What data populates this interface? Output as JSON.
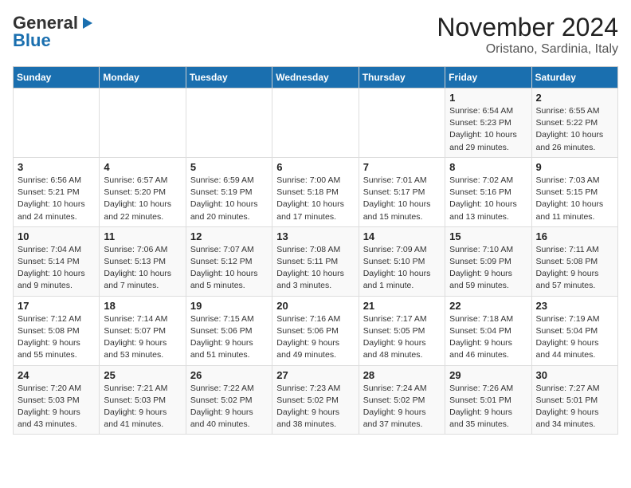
{
  "header": {
    "logo_line1": "General",
    "logo_line2": "Blue",
    "month": "November 2024",
    "location": "Oristano, Sardinia, Italy"
  },
  "weekdays": [
    "Sunday",
    "Monday",
    "Tuesday",
    "Wednesday",
    "Thursday",
    "Friday",
    "Saturday"
  ],
  "weeks": [
    [
      {
        "day": "",
        "info": ""
      },
      {
        "day": "",
        "info": ""
      },
      {
        "day": "",
        "info": ""
      },
      {
        "day": "",
        "info": ""
      },
      {
        "day": "",
        "info": ""
      },
      {
        "day": "1",
        "info": "Sunrise: 6:54 AM\nSunset: 5:23 PM\nDaylight: 10 hours and 29 minutes."
      },
      {
        "day": "2",
        "info": "Sunrise: 6:55 AM\nSunset: 5:22 PM\nDaylight: 10 hours and 26 minutes."
      }
    ],
    [
      {
        "day": "3",
        "info": "Sunrise: 6:56 AM\nSunset: 5:21 PM\nDaylight: 10 hours and 24 minutes."
      },
      {
        "day": "4",
        "info": "Sunrise: 6:57 AM\nSunset: 5:20 PM\nDaylight: 10 hours and 22 minutes."
      },
      {
        "day": "5",
        "info": "Sunrise: 6:59 AM\nSunset: 5:19 PM\nDaylight: 10 hours and 20 minutes."
      },
      {
        "day": "6",
        "info": "Sunrise: 7:00 AM\nSunset: 5:18 PM\nDaylight: 10 hours and 17 minutes."
      },
      {
        "day": "7",
        "info": "Sunrise: 7:01 AM\nSunset: 5:17 PM\nDaylight: 10 hours and 15 minutes."
      },
      {
        "day": "8",
        "info": "Sunrise: 7:02 AM\nSunset: 5:16 PM\nDaylight: 10 hours and 13 minutes."
      },
      {
        "day": "9",
        "info": "Sunrise: 7:03 AM\nSunset: 5:15 PM\nDaylight: 10 hours and 11 minutes."
      }
    ],
    [
      {
        "day": "10",
        "info": "Sunrise: 7:04 AM\nSunset: 5:14 PM\nDaylight: 10 hours and 9 minutes."
      },
      {
        "day": "11",
        "info": "Sunrise: 7:06 AM\nSunset: 5:13 PM\nDaylight: 10 hours and 7 minutes."
      },
      {
        "day": "12",
        "info": "Sunrise: 7:07 AM\nSunset: 5:12 PM\nDaylight: 10 hours and 5 minutes."
      },
      {
        "day": "13",
        "info": "Sunrise: 7:08 AM\nSunset: 5:11 PM\nDaylight: 10 hours and 3 minutes."
      },
      {
        "day": "14",
        "info": "Sunrise: 7:09 AM\nSunset: 5:10 PM\nDaylight: 10 hours and 1 minute."
      },
      {
        "day": "15",
        "info": "Sunrise: 7:10 AM\nSunset: 5:09 PM\nDaylight: 9 hours and 59 minutes."
      },
      {
        "day": "16",
        "info": "Sunrise: 7:11 AM\nSunset: 5:08 PM\nDaylight: 9 hours and 57 minutes."
      }
    ],
    [
      {
        "day": "17",
        "info": "Sunrise: 7:12 AM\nSunset: 5:08 PM\nDaylight: 9 hours and 55 minutes."
      },
      {
        "day": "18",
        "info": "Sunrise: 7:14 AM\nSunset: 5:07 PM\nDaylight: 9 hours and 53 minutes."
      },
      {
        "day": "19",
        "info": "Sunrise: 7:15 AM\nSunset: 5:06 PM\nDaylight: 9 hours and 51 minutes."
      },
      {
        "day": "20",
        "info": "Sunrise: 7:16 AM\nSunset: 5:06 PM\nDaylight: 9 hours and 49 minutes."
      },
      {
        "day": "21",
        "info": "Sunrise: 7:17 AM\nSunset: 5:05 PM\nDaylight: 9 hours and 48 minutes."
      },
      {
        "day": "22",
        "info": "Sunrise: 7:18 AM\nSunset: 5:04 PM\nDaylight: 9 hours and 46 minutes."
      },
      {
        "day": "23",
        "info": "Sunrise: 7:19 AM\nSunset: 5:04 PM\nDaylight: 9 hours and 44 minutes."
      }
    ],
    [
      {
        "day": "24",
        "info": "Sunrise: 7:20 AM\nSunset: 5:03 PM\nDaylight: 9 hours and 43 minutes."
      },
      {
        "day": "25",
        "info": "Sunrise: 7:21 AM\nSunset: 5:03 PM\nDaylight: 9 hours and 41 minutes."
      },
      {
        "day": "26",
        "info": "Sunrise: 7:22 AM\nSunset: 5:02 PM\nDaylight: 9 hours and 40 minutes."
      },
      {
        "day": "27",
        "info": "Sunrise: 7:23 AM\nSunset: 5:02 PM\nDaylight: 9 hours and 38 minutes."
      },
      {
        "day": "28",
        "info": "Sunrise: 7:24 AM\nSunset: 5:02 PM\nDaylight: 9 hours and 37 minutes."
      },
      {
        "day": "29",
        "info": "Sunrise: 7:26 AM\nSunset: 5:01 PM\nDaylight: 9 hours and 35 minutes."
      },
      {
        "day": "30",
        "info": "Sunrise: 7:27 AM\nSunset: 5:01 PM\nDaylight: 9 hours and 34 minutes."
      }
    ]
  ]
}
